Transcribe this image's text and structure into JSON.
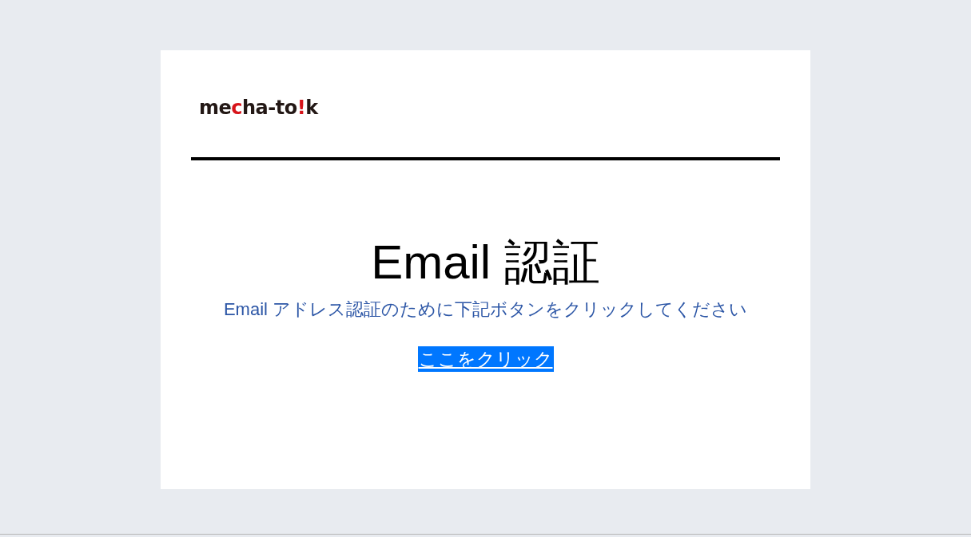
{
  "logo": [
    {
      "text": "me",
      "color": "#231815"
    },
    {
      "text": "c",
      "color": "#d7141a"
    },
    {
      "text": "ha-to",
      "color": "#231815"
    },
    {
      "text": "!",
      "color": "#d7141a"
    },
    {
      "text": "k",
      "color": "#231815"
    }
  ],
  "title": "Email 認証",
  "message": "Email アドレス認証のために下記ボタンをクリックしてください",
  "link": "ここをクリック"
}
